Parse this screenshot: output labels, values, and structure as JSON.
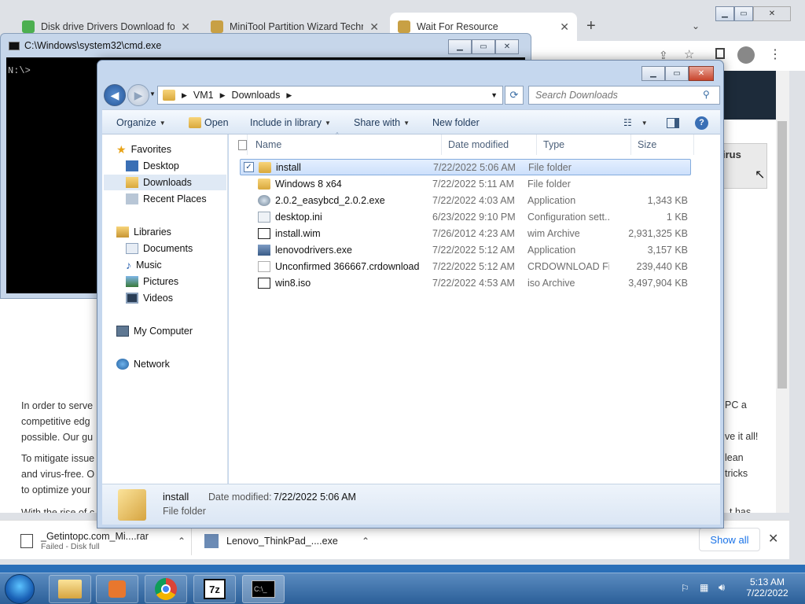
{
  "browser": {
    "tabs": [
      {
        "title": "Disk drive Drivers Download for",
        "favicon_color": "#4caf50"
      },
      {
        "title": "MiniTool Partition Wizard Technic",
        "favicon_color": "#c8a044"
      },
      {
        "title": "Wait For Resource",
        "favicon_color": "#c8a044"
      }
    ],
    "new_tab": "+",
    "page_text": {
      "p1_l1": "In order to serve",
      "p1_l2": "competitive edg",
      "p1_l3": "possible. Our gu",
      "p2_l1": "To mitigate issue",
      "p2_l2": "and virus-free. O",
      "p2_l3": "to optimize your",
      "p3_l1": "With the rise of c",
      "r1": "PC a",
      "r2": "ve it all!",
      "r3": "lean",
      "r4": "tricks",
      "r5": "t has",
      "banner": "irus"
    },
    "downloads": [
      {
        "name": "_Getintopc.com_Mi....rar",
        "status": "Failed - Disk full"
      },
      {
        "name": "Lenovo_ThinkPad_....exe",
        "status": ""
      }
    ],
    "show_all": "Show all"
  },
  "cmd": {
    "title": "C:\\Windows\\system32\\cmd.exe",
    "prompt": "N:\\>"
  },
  "explorer": {
    "breadcrumb": [
      "VM1",
      "Downloads"
    ],
    "search_placeholder": "Search Downloads",
    "commands": [
      "Organize",
      "Open",
      "Include in library",
      "Share with",
      "New folder"
    ],
    "nav": {
      "favorites": "Favorites",
      "fav_items": [
        "Desktop",
        "Downloads",
        "Recent Places"
      ],
      "libraries": "Libraries",
      "lib_items": [
        "Documents",
        "Music",
        "Pictures",
        "Videos"
      ],
      "computer": "My Computer",
      "network": "Network"
    },
    "columns": [
      "Name",
      "Date modified",
      "Type",
      "Size"
    ],
    "files": [
      {
        "name": "install",
        "date": "7/22/2022 5:06 AM",
        "type": "File folder",
        "size": "",
        "icon": "folder-icon"
      },
      {
        "name": "Windows 8 x64",
        "date": "7/22/2022 5:11 AM",
        "type": "File folder",
        "size": "",
        "icon": "folder-icon"
      },
      {
        "name": "2.0.2_easybcd_2.0.2.exe",
        "date": "7/22/2022 4:03 AM",
        "type": "Application",
        "size": "1,343 KB",
        "icon": "installer-icon"
      },
      {
        "name": "desktop.ini",
        "date": "6/23/2022 9:10 PM",
        "type": "Configuration sett...",
        "size": "1 KB",
        "icon": "settings-file-icon"
      },
      {
        "name": "install.wim",
        "date": "7/26/2012 4:23 AM",
        "type": "wim Archive",
        "size": "2,931,325 KB",
        "icon": "archive-icon"
      },
      {
        "name": "lenovodrivers.exe",
        "date": "7/22/2022 5:12 AM",
        "type": "Application",
        "size": "3,157 KB",
        "icon": "installer-icon"
      },
      {
        "name": "Unconfirmed 366667.crdownload",
        "date": "7/22/2022 5:12 AM",
        "type": "CRDOWNLOAD File",
        "size": "239,440 KB",
        "icon": "blank-file-icon"
      },
      {
        "name": "win8.iso",
        "date": "7/22/2022 4:53 AM",
        "type": "iso Archive",
        "size": "3,497,904 KB",
        "icon": "iso-icon"
      }
    ],
    "details": {
      "name": "install",
      "date_label": "Date modified:",
      "date_value": "7/22/2022 5:06 AM",
      "type": "File folder"
    }
  },
  "taskbar": {
    "time": "5:13 AM",
    "date": "7/22/2022"
  }
}
